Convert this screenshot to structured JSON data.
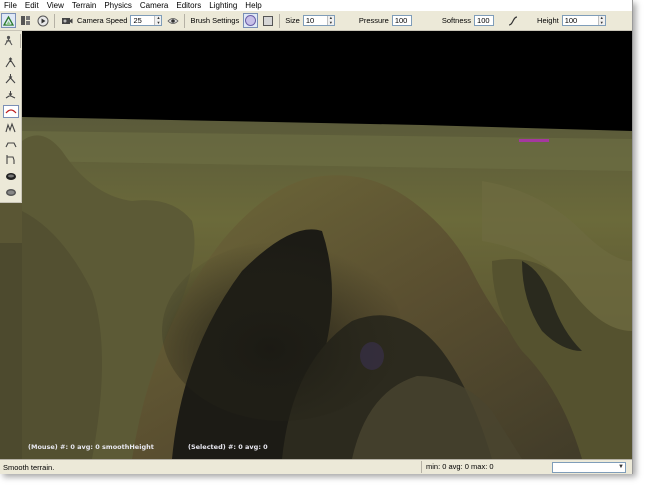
{
  "menubar": {
    "items": [
      "File",
      "Edit",
      "View",
      "Terrain",
      "Physics",
      "Camera",
      "Editors",
      "Lighting",
      "Help"
    ]
  },
  "toolbar": {
    "camera_speed_label": "Camera Speed",
    "camera_speed_value": "25",
    "brush_settings_label": "Brush Settings",
    "size_label": "Size",
    "size_value": "10",
    "pressure_label": "Pressure",
    "pressure_value": "100",
    "softness_label": "Softness",
    "softness_value": "100",
    "height_label": "Height",
    "height_value": "100",
    "icons": [
      "terrain-brush-icon",
      "panels-icon",
      "play-icon",
      "camera-icon",
      "eye-icon",
      "brush-round-icon",
      "brush-square-icon",
      "softness-curve-icon"
    ]
  },
  "tool_palette": {
    "icons": [
      "terrain-icon",
      "pencil-icon",
      "sphere-icon",
      "cube-icon",
      "image-icon",
      "teapot-icon",
      "leaf-icon",
      "bucket-icon",
      "select-icon",
      "tree-icon",
      "spray-icon",
      "character-icon",
      "bulb-icon"
    ]
  },
  "terrain_tools": {
    "icons": [
      "raise-height-icon",
      "lower-height-icon",
      "smooth-icon",
      "adjust-height-icon",
      "noise-icon",
      "flatten-icon",
      "paint-icon",
      "hole-icon",
      "erase-icon"
    ]
  },
  "viewport": {
    "mouse_info": "(Mouse) #: 0  avg: 0 smoothHeight",
    "selected_info": "(Selected) #: 0  avg: 0"
  },
  "statusbar": {
    "message": "Smooth terrain.",
    "stats": "min: 0  avg: 0  max: 0",
    "dropdown_value": ""
  },
  "colors": {
    "toolbar_bg": "#ece9d8",
    "sky": "#000000",
    "terrain_accent": "#6b6a3a"
  }
}
